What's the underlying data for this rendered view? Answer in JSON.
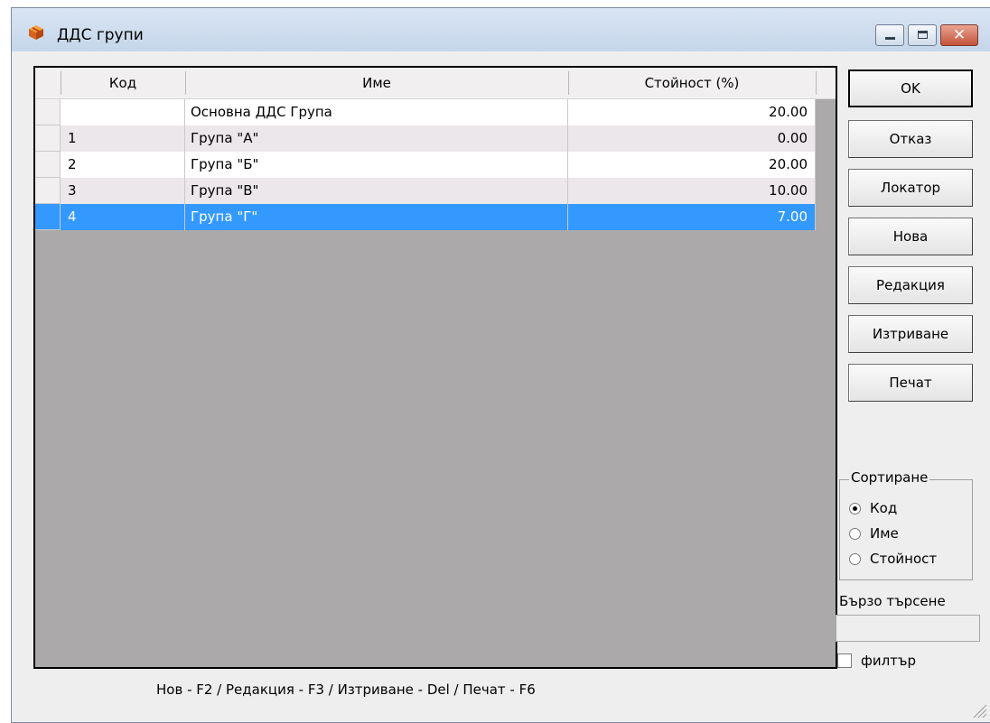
{
  "window": {
    "title": "ДДС групи",
    "app_icon": "box-icon"
  },
  "grid": {
    "columns": [
      "Код",
      "Име",
      "Стойност (%)"
    ],
    "rows": [
      {
        "kod": "",
        "ime": "Основна ДДС Група",
        "value": "20.00"
      },
      {
        "kod": "1",
        "ime": "Група \"А\"",
        "value": "0.00"
      },
      {
        "kod": "2",
        "ime": "Група \"Б\"",
        "value": "20.00"
      },
      {
        "kod": "3",
        "ime": "Група \"В\"",
        "value": "10.00"
      },
      {
        "kod": "4",
        "ime": "Група \"Г\"",
        "value": "7.00"
      }
    ],
    "selected_row": 4
  },
  "buttons": {
    "ok": "OK",
    "cancel": "Отказ",
    "locator": "Локатор",
    "new": "Нова",
    "edit": "Редакция",
    "delete": "Изтриване",
    "print": "Печат"
  },
  "sort": {
    "legend": "Сортиране",
    "options": [
      "Код",
      "Име",
      "Стойност"
    ],
    "selected": 0
  },
  "quick_search": {
    "label": "Бързо търсене",
    "value": ""
  },
  "filter": {
    "label": "филтър",
    "checked": false
  },
  "hint": "Нов - F2 / Редакция - F3 / Изтриване - Del / Печат - F6",
  "colors": {
    "selection": "#3399ff",
    "grid_background": "#aba9aa",
    "row_alt": "#ebe7ea"
  }
}
